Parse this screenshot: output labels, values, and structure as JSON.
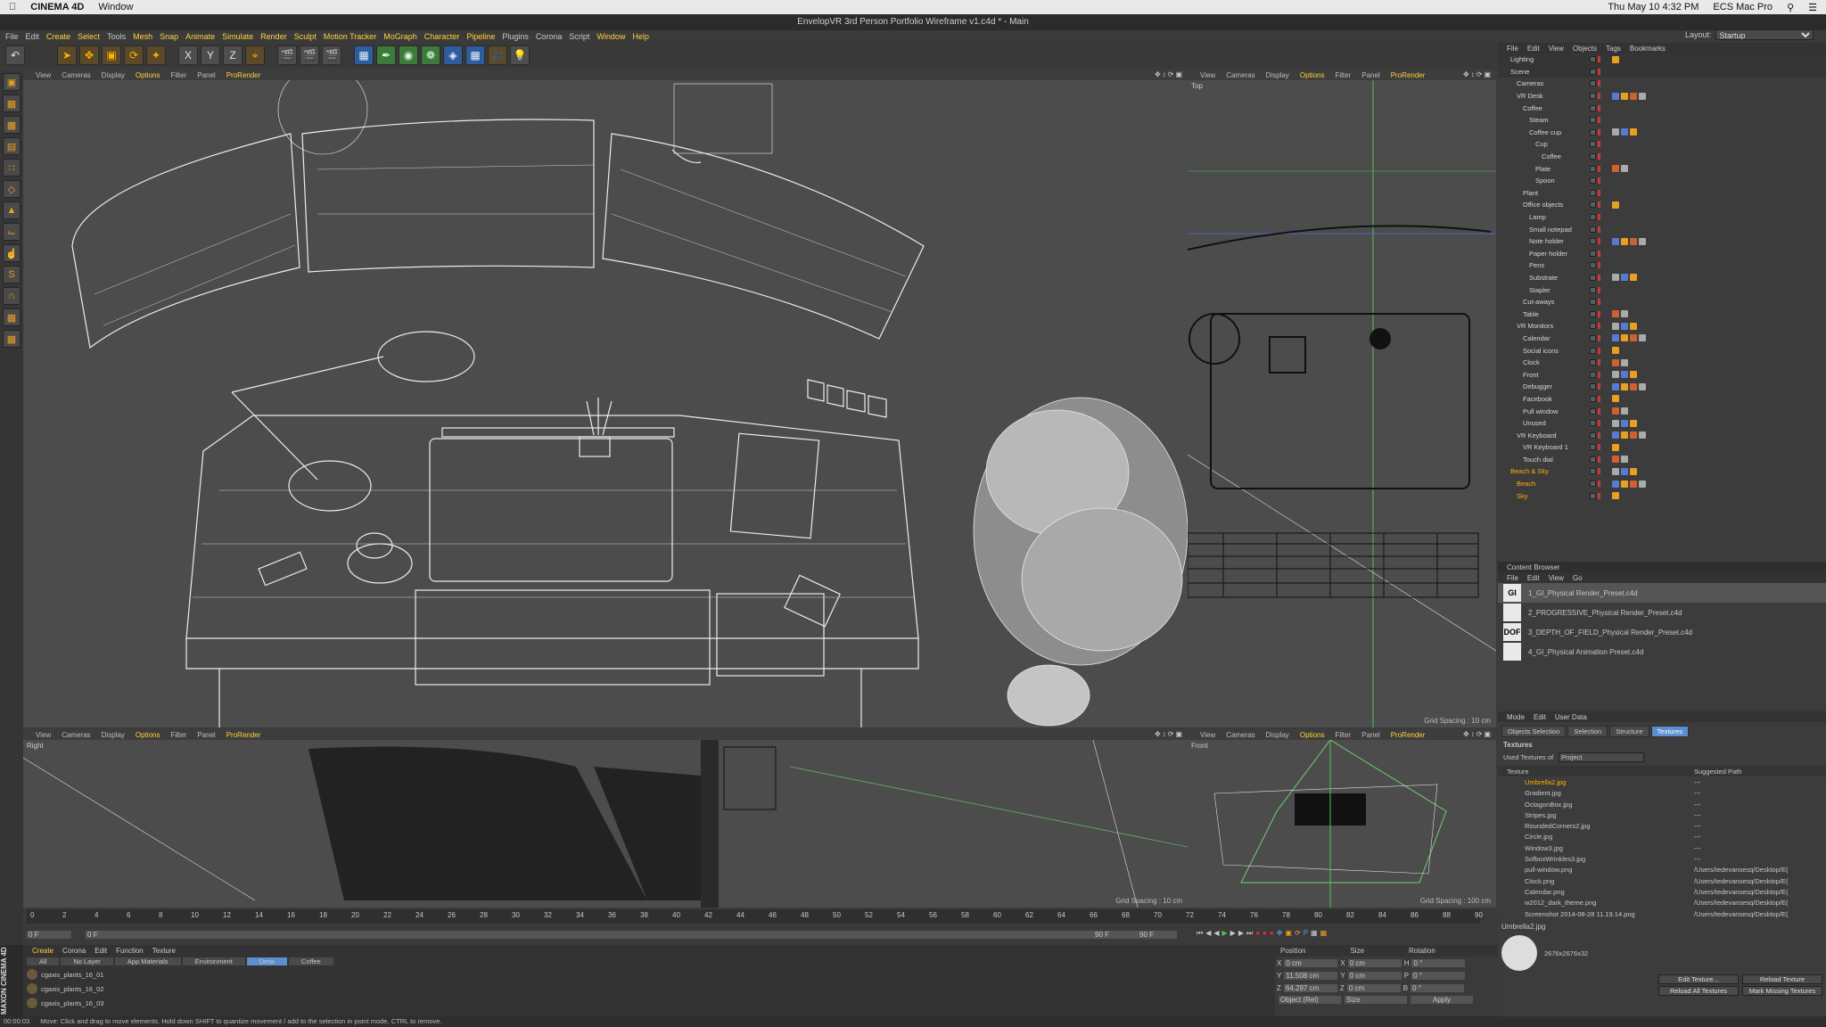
{
  "mac_menu": {
    "app": "CINEMA 4D",
    "window": "Window",
    "right_items": [
      "Thu May 10  4:32 PM",
      "ECS Mac Pro"
    ]
  },
  "title": "EnvelopVR 3rd Person Portfolio Wireframe v1.c4d * - Main",
  "main_menu": [
    "File",
    "Edit",
    "Create",
    "Select",
    "Tools",
    "Mesh",
    "Snap",
    "Animate",
    "Simulate",
    "Render",
    "Sculpt",
    "Motion Tracker",
    "MoGraph",
    "Character",
    "Pipeline",
    "Plugins",
    "Corona",
    "Script",
    "Window",
    "Help"
  ],
  "layout": {
    "label": "Layout:",
    "value": "Startup"
  },
  "viewport_menu": [
    "View",
    "Cameras",
    "Display",
    "Options",
    "Filter",
    "Panel",
    "ProRender"
  ],
  "viewports": {
    "top_right_label": "Top",
    "bottom_left_label": "Right",
    "bottom_right_label": "Front",
    "grid_tr": "Grid Spacing : 10 cm",
    "grid_bl": "Grid Spacing : 10 cm",
    "grid_br": "Grid Spacing : 100 cm"
  },
  "object_manager": {
    "menu": [
      "File",
      "Edit",
      "View",
      "Objects",
      "Tags",
      "Bookmarks"
    ],
    "rows": [
      {
        "name": "Lighting",
        "indent": 0
      },
      {
        "name": "Scene",
        "indent": 0
      },
      {
        "name": "Cameras",
        "indent": 1
      },
      {
        "name": "VR Desk",
        "indent": 1
      },
      {
        "name": "Coffee",
        "indent": 2
      },
      {
        "name": "Steam",
        "indent": 3
      },
      {
        "name": "Coffee cup",
        "indent": 3
      },
      {
        "name": "Cup",
        "indent": 4
      },
      {
        "name": "Coffee",
        "indent": 5
      },
      {
        "name": "Plate",
        "indent": 4
      },
      {
        "name": "Spoon",
        "indent": 4
      },
      {
        "name": "Plant",
        "indent": 2
      },
      {
        "name": "Office objects",
        "indent": 2
      },
      {
        "name": "Lamp",
        "indent": 3
      },
      {
        "name": "Small notepad",
        "indent": 3
      },
      {
        "name": "Note holder",
        "indent": 3
      },
      {
        "name": "Paper holder",
        "indent": 3
      },
      {
        "name": "Pens",
        "indent": 3
      },
      {
        "name": "Substrate",
        "indent": 3
      },
      {
        "name": "Stapler",
        "indent": 3
      },
      {
        "name": "Cut-aways",
        "indent": 2
      },
      {
        "name": "Table",
        "indent": 2
      },
      {
        "name": "VR Monitors",
        "indent": 1
      },
      {
        "name": "Calendar",
        "indent": 2
      },
      {
        "name": "Social icons",
        "indent": 2
      },
      {
        "name": "Clock",
        "indent": 2
      },
      {
        "name": "Front",
        "indent": 2
      },
      {
        "name": "Debugger",
        "indent": 2
      },
      {
        "name": "Facebook",
        "indent": 2
      },
      {
        "name": "Pull window",
        "indent": 2
      },
      {
        "name": "Unused",
        "indent": 2
      },
      {
        "name": "VR Keyboard",
        "indent": 1
      },
      {
        "name": "VR Keyboard 1",
        "indent": 2
      },
      {
        "name": "Touch dial",
        "indent": 2
      },
      {
        "name": "Beach & Sky",
        "indent": 0
      },
      {
        "name": "Beach",
        "indent": 1
      },
      {
        "name": "Sky",
        "indent": 1
      }
    ]
  },
  "content_browser": {
    "title": "Content Browser",
    "menu": [
      "File",
      "Edit",
      "View",
      "Go"
    ],
    "items": [
      {
        "thumb": "GI",
        "name": "1_GI_Physical Render_Preset.c4d"
      },
      {
        "thumb": "",
        "name": "2_PROGRESSIVE_Physical Render_Preset.c4d"
      },
      {
        "thumb": "DOF",
        "name": "3_DEPTH_OF_FIELD_Physical Render_Preset.c4d"
      },
      {
        "thumb": "",
        "name": "4_GI_Physical Animation Preset.c4d"
      }
    ]
  },
  "attributes": {
    "menu": [
      "Mode",
      "Edit",
      "User Data"
    ],
    "tabs": [
      "Objects Selection",
      "Selection",
      "Structure",
      "Textures"
    ],
    "section": "Textures",
    "used_label": "Used Textures of",
    "used_value": "Project",
    "col_texture": "Texture",
    "col_path": "Suggested Path",
    "textures": [
      {
        "name": "Umbrella2.jpg",
        "path": "---"
      },
      {
        "name": "Gradient.jpg",
        "path": "---"
      },
      {
        "name": "OctagonBox.jpg",
        "path": "---"
      },
      {
        "name": "Stripes.jpg",
        "path": "---"
      },
      {
        "name": "RoundedCorners2.jpg",
        "path": "---"
      },
      {
        "name": "Circle.jpg",
        "path": "---"
      },
      {
        "name": "Window3.jpg",
        "path": "---"
      },
      {
        "name": "SofboxWrinkles3.jpg",
        "path": "---"
      },
      {
        "name": "pull-window.png",
        "path": "/Users/tedevansesq/Desktop/E("
      },
      {
        "name": "Clock.png",
        "path": "/Users/tedevansesq/Desktop/E("
      },
      {
        "name": "Calendar.png",
        "path": "/Users/tedevansesq/Desktop/E("
      },
      {
        "name": "w2012_dark_theme.png",
        "path": "/Users/tedevansesq/Desktop/E("
      },
      {
        "name": "Screenshot 2014-08-28 11.19.14.png",
        "path": "/Users/tedevansesq/Desktop/E("
      }
    ],
    "preview_name": "Umbrella2.jpg",
    "preview_size": "2676x2676x32",
    "btn_edit": "Edit Texture...",
    "btn_reload": "Reload Texture",
    "btn_reload_all": "Reload All Textures",
    "btn_mark": "Mark Missing Textures"
  },
  "timeline": {
    "ticks": [
      "0",
      "2",
      "4",
      "6",
      "8",
      "10",
      "12",
      "14",
      "16",
      "18",
      "20",
      "22",
      "24",
      "26",
      "28",
      "30",
      "32",
      "34",
      "36",
      "38",
      "40",
      "42",
      "44",
      "46",
      "48",
      "50",
      "52",
      "54",
      "56",
      "58",
      "60",
      "62",
      "64",
      "66",
      "68",
      "70",
      "72",
      "74",
      "76",
      "78",
      "80",
      "82",
      "84",
      "86",
      "88",
      "90"
    ],
    "start": "0 F",
    "current": "0 F",
    "end_a": "90 F",
    "end_b": "90 F",
    "right_frame": "0 F"
  },
  "material_manager": {
    "menu": [
      "Create",
      "Corona",
      "Edit",
      "Function",
      "Texture"
    ],
    "tabs": [
      "All",
      "No Layer",
      "App Materials",
      "Environment",
      "Desk",
      "Coffee"
    ],
    "materials": [
      "cgaxis_plants_16_01",
      "cgaxis_plants_16_02",
      "cgaxis_plants_16_03"
    ]
  },
  "coords": {
    "headers": [
      "Position",
      "Size",
      "Rotation"
    ],
    "rows": [
      {
        "axis": "X",
        "pos": "0 cm",
        "s": "X",
        "size": "0 cm",
        "r": "H",
        "rot": "0 °"
      },
      {
        "axis": "Y",
        "pos": "11.508 cm",
        "s": "Y",
        "size": "0 cm",
        "r": "P",
        "rot": "0 °"
      },
      {
        "axis": "Z",
        "pos": "64.297 cm",
        "s": "Z",
        "size": "0 cm",
        "r": "B",
        "rot": "0 °"
      }
    ],
    "mode": "Object (Rel)",
    "size_mode": "Size",
    "apply": "Apply"
  },
  "status": {
    "time": "00:00:03",
    "text": "Move: Click and drag to move elements. Hold down SHIFT to quantize movement / add to the selection in point mode, CTRL to remove."
  },
  "brand": "MAXON CINEMA 4D"
}
